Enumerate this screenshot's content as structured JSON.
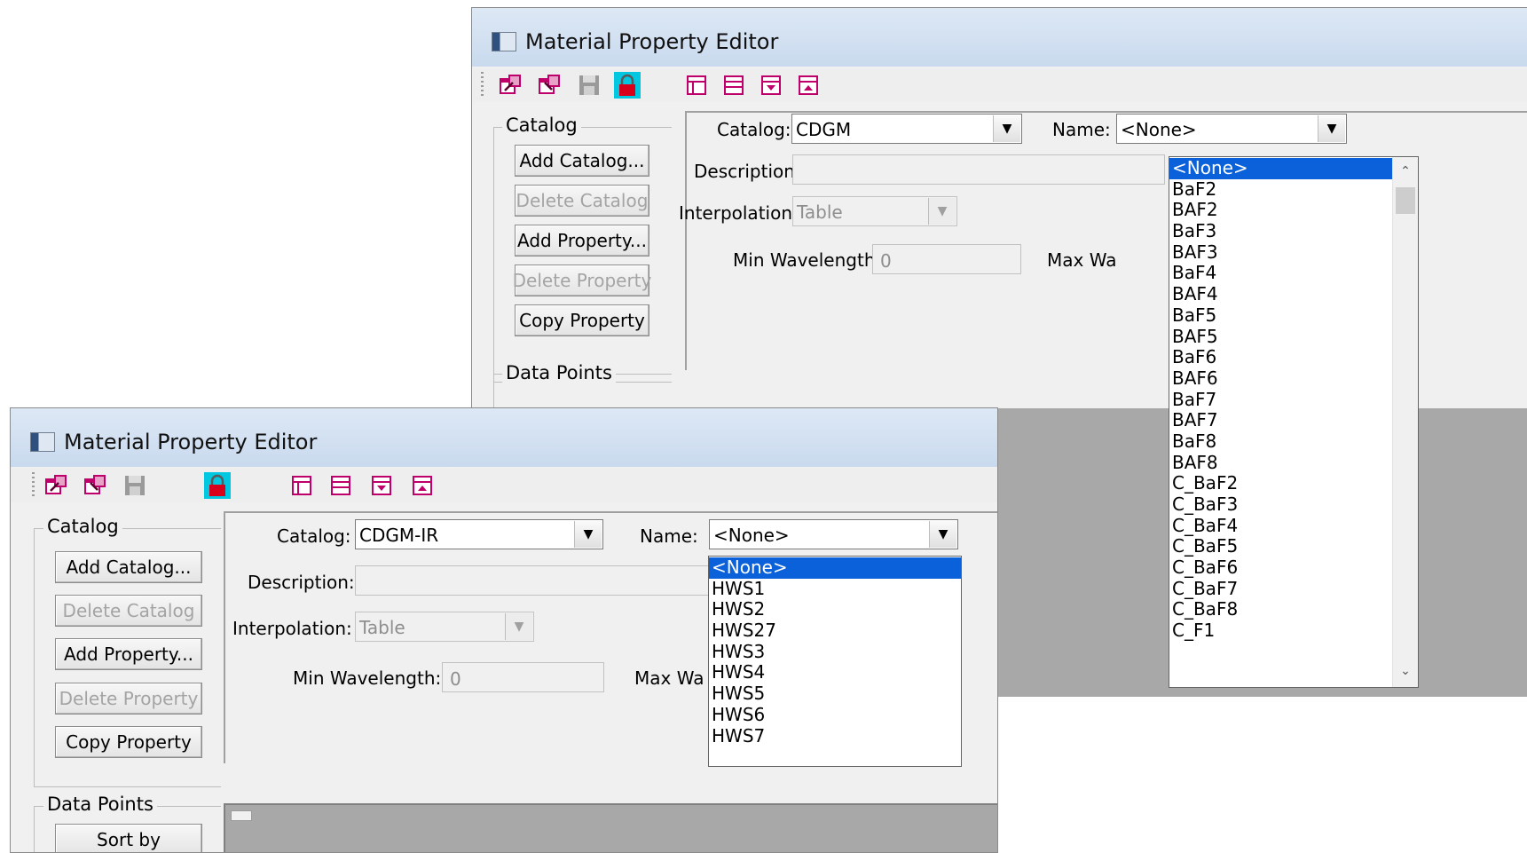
{
  "back_window": {
    "title": "Material Property Editor",
    "catalog_group": {
      "legend": "Catalog",
      "buttons": {
        "add_catalog": "Add Catalog...",
        "delete_catalog": "Delete Catalog",
        "add_property": "Add  Property...",
        "delete_property": "Delete Property",
        "copy_property": "Copy Property"
      }
    },
    "data_points_legend": "Data Points",
    "form": {
      "catalog_label": "Catalog:",
      "catalog_value": "CDGM",
      "name_label": "Name:",
      "name_value": "<None>",
      "description_label": "Description:",
      "interpolation_label": "Interpolation:",
      "interpolation_value": "Table",
      "min_wavelength_label": "Min Wavelength:",
      "min_wavelength_value": "0",
      "max_wavelength_label": "Max Wa"
    },
    "name_dropdown": {
      "items": [
        "<None>",
        "BaF2",
        "BAF2",
        "BaF3",
        "BAF3",
        "BaF4",
        "BAF4",
        "BaF5",
        "BAF5",
        "BaF6",
        "BAF6",
        "BaF7",
        "BAF7",
        "BaF8",
        "BAF8",
        "C_BaF2",
        "C_BaF3",
        "C_BaF4",
        "C_BaF5",
        "C_BaF6",
        "C_BaF7",
        "C_BaF8",
        "C_F1"
      ],
      "selected_index": 0
    }
  },
  "front_window": {
    "title": "Material Property Editor",
    "catalog_group": {
      "legend": "Catalog",
      "buttons": {
        "add_catalog": "Add Catalog...",
        "delete_catalog": "Delete Catalog",
        "add_property": "Add  Property...",
        "delete_property": "Delete Property",
        "copy_property": "Copy Property"
      }
    },
    "data_points_group": {
      "legend": "Data Points",
      "sort_button": "Sort by"
    },
    "form": {
      "catalog_label": "Catalog:",
      "catalog_value": "CDGM-IR",
      "name_label": "Name:",
      "name_value": "<None>",
      "description_label": "Description:",
      "interpolation_label": "Interpolation:",
      "interpolation_value": "Table",
      "min_wavelength_label": "Min Wavelength:",
      "min_wavelength_value": "0",
      "max_wavelength_label": "Max Wa"
    },
    "name_dropdown": {
      "items": [
        "<None>",
        "HWS1",
        "HWS2",
        "HWS27",
        "HWS3",
        "HWS4",
        "HWS5",
        "HWS6",
        "HWS7"
      ],
      "selected_index": 0
    }
  },
  "toolbar_icons": [
    "import-icon",
    "export-icon",
    "save-icon",
    "lock-icon",
    "column-layout-icon",
    "row-layout-icon",
    "arrow-down-icon",
    "arrow-up-icon"
  ],
  "colors": {
    "selection": "#0a61d9",
    "toolbar_icon": "#c0006a",
    "lock_bg": "#00c8e0",
    "lock_body": "#d8001a",
    "empty_area": "#a8a8a8"
  }
}
